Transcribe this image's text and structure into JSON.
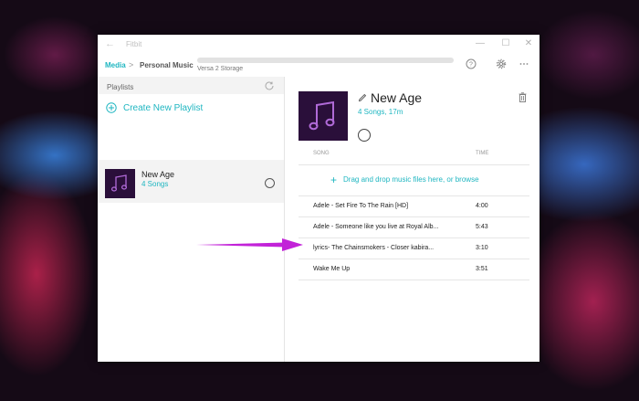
{
  "window": {
    "title": "Fitbit",
    "back_glyph": "←",
    "minimize_glyph": "—",
    "maximize_glyph": "☐",
    "close_glyph": "✕"
  },
  "header": {
    "breadcrumb_root": "Media",
    "breadcrumb_sep": ">",
    "breadcrumb_current": "Personal Music",
    "storage_label": "Versa 2 Storage",
    "icons": [
      "help-icon",
      "gear-icon",
      "more-icon"
    ]
  },
  "sidebar": {
    "header": "Playlists",
    "create_label": "Create New Playlist",
    "playlists": [
      {
        "name": "New Age",
        "count": "4 Songs"
      }
    ]
  },
  "playlist": {
    "title": "New Age",
    "subtitle": "4 Songs, 17m",
    "col_song": "SONG",
    "col_time": "TIME",
    "drop_label": "Drag and drop music files here, or browse",
    "songs": [
      {
        "title": "Adele - Set Fire To The Rain [HD]",
        "time": "4:00"
      },
      {
        "title": "Adele - Someone like you live at Royal Alb...",
        "time": "5:43"
      },
      {
        "title": "lyrics- The Chainsmokers - Closer   kabira...",
        "time": "3:10"
      },
      {
        "title": "Wake Me Up",
        "time": "3:51"
      }
    ]
  },
  "colors": {
    "accent": "#1fb6c1",
    "annotation_arrow": "#c222d8",
    "cover_art_bg": "#2a0f3a",
    "cover_art_note": "#b06ad8"
  }
}
